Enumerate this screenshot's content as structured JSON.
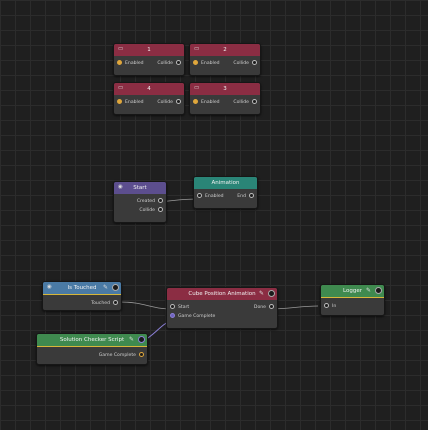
{
  "nodes": {
    "n1": {
      "title": "1",
      "in": "Enabled",
      "out": "Collide"
    },
    "n2": {
      "title": "2",
      "in": "Enabled",
      "out": "Collide"
    },
    "n4": {
      "title": "4",
      "in": "Enabled",
      "out": "Collide"
    },
    "n3": {
      "title": "3",
      "in": "Enabled",
      "out": "Collide"
    },
    "start": {
      "title": "Start",
      "created": "Created",
      "collide": "Collide"
    },
    "animation": {
      "title": "Animation",
      "in": "Enabled",
      "out": "End"
    },
    "touched": {
      "title": "Is Touched",
      "out": "Touched"
    },
    "cube": {
      "title": "Cube Position Animation",
      "start": "Start",
      "done": "Done",
      "game_complete": "Game Complete"
    },
    "logger": {
      "title": "Logger",
      "in": "In"
    },
    "checker": {
      "title": "Solution Checker Script",
      "out": "Game Complete"
    }
  },
  "icons": {
    "pin": "pin-icon",
    "toggle": "toggle-dot-icon"
  }
}
